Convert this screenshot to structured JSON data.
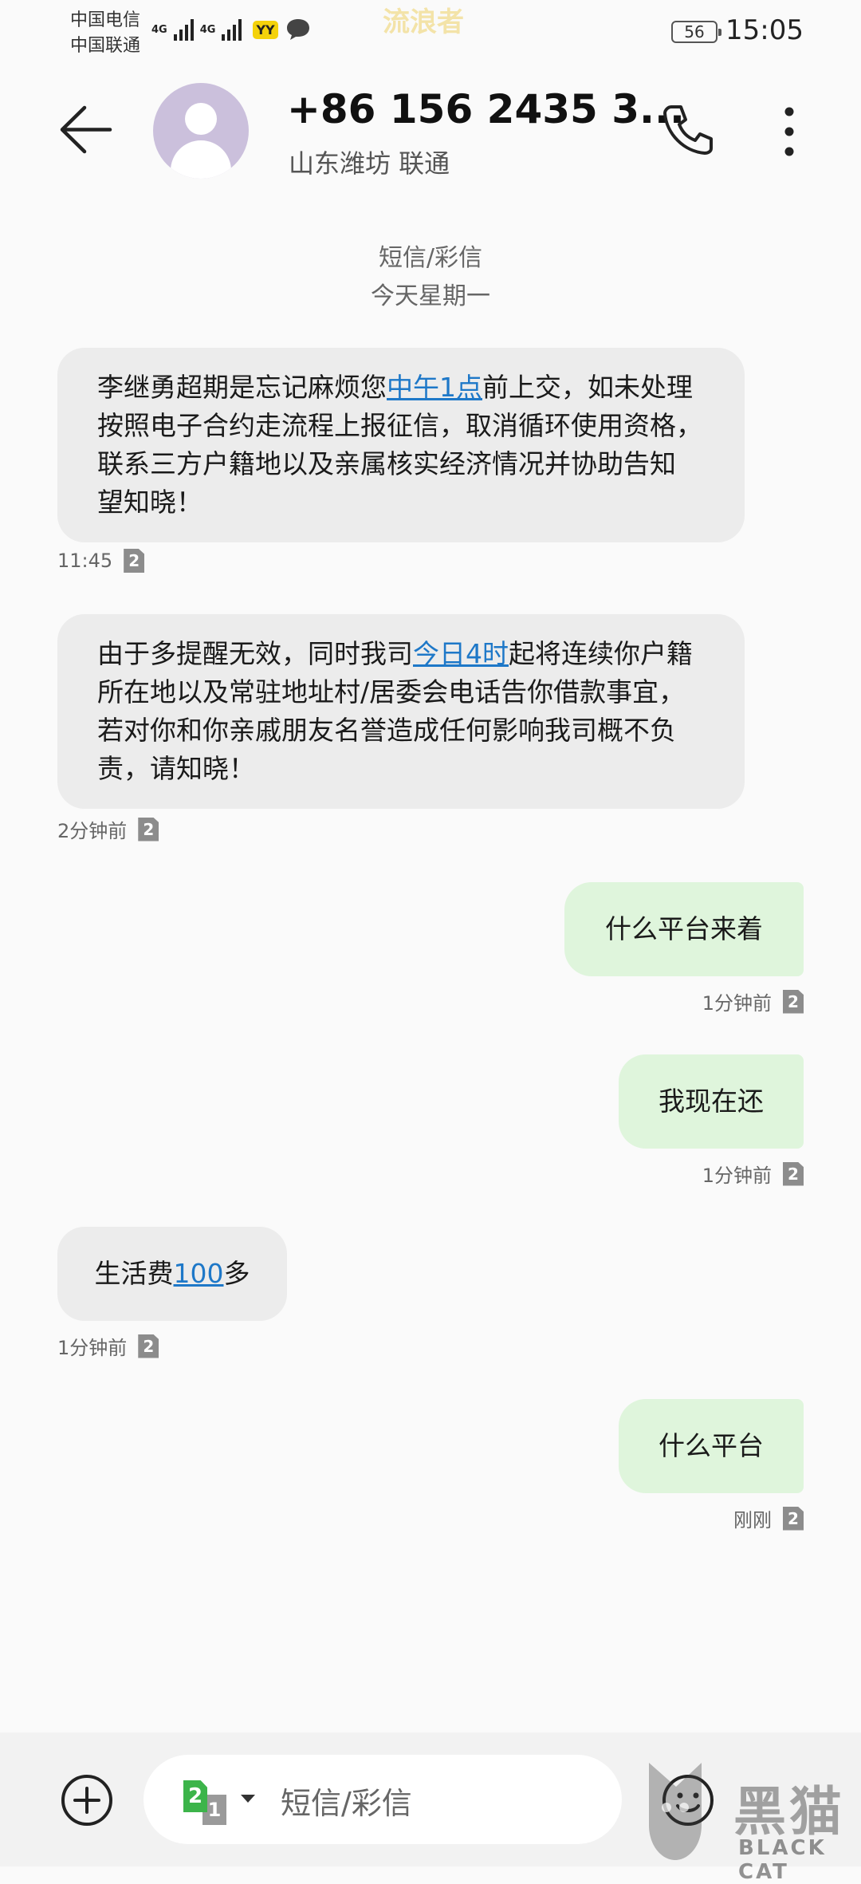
{
  "status_bar": {
    "carrier_1": "中国电信",
    "carrier_2": "中国联通",
    "network_1": "4G",
    "network_2": "4G",
    "app_badge": "YY",
    "watermark": "流浪者",
    "battery": "56",
    "time": "15:05"
  },
  "header": {
    "contact_name": "+86 156 2435 3...",
    "contact_location": "山东潍坊 联通",
    "icons": [
      "back-arrow-icon",
      "avatar-icon",
      "phone-icon",
      "more-vertical-icon"
    ]
  },
  "thread": {
    "channel": "短信/彩信",
    "date": "今天星期一"
  },
  "messages": [
    {
      "direction": "incoming",
      "parts": [
        "李继勇超期是忘记麻烦您",
        "中午1点",
        "前上交，如未处理按照电子合约走流程上报征信，取消循环使用资格，联系三方户籍地以及亲属核实经济情况并协助告知 望知晓！"
      ],
      "time": "11:45",
      "sim": "2"
    },
    {
      "direction": "incoming",
      "parts": [
        "由于多提醒无效，同时我司",
        "今日4时",
        "起将连续你户籍所在地以及常驻地址村/居委会电话告你借款事宜，若对你和你亲戚朋友名誉造成任何影响我司概不负责，请知晓！"
      ],
      "time": "2分钟前",
      "sim": "2"
    },
    {
      "direction": "outgoing",
      "text": "什么平台来着",
      "time": "1分钟前",
      "sim": "2"
    },
    {
      "direction": "outgoing",
      "text": "我现在还",
      "time": "1分钟前",
      "sim": "2"
    },
    {
      "direction": "incoming",
      "parts": [
        "生活费",
        "100",
        "多"
      ],
      "time": "1分钟前",
      "sim": "2"
    },
    {
      "direction": "outgoing",
      "text": "什么平台",
      "time": "刚刚",
      "sim": "2"
    }
  ],
  "composer": {
    "sim_active": "2",
    "sim_inactive": "1",
    "placeholder": "短信/彩信",
    "icons": [
      "add-icon",
      "emoji-icon"
    ]
  },
  "watermark_logo": {
    "text": "黑猫",
    "subtext": "BLACK CAT"
  },
  "colors": {
    "incoming_bubble": "#ececec",
    "outgoing_bubble": "#dff5dc",
    "link": "#1e78c8",
    "avatar": "#cbc0dc"
  }
}
